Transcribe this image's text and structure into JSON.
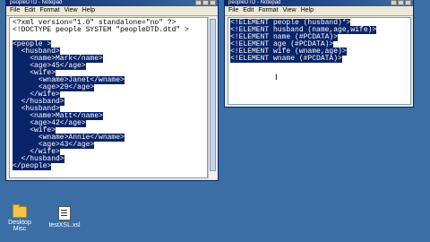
{
  "left_window": {
    "title": "peopleDTD - Notepad",
    "menu": [
      "File",
      "Edit",
      "Format",
      "View",
      "Help"
    ],
    "lines": [
      {
        "text": "<?xml version=\"1.0\" standalone=\"no\" ?>",
        "sel": false
      },
      {
        "text": "<!DOCTYPE people SYSTEM \"peopleDTD.dtd\" >",
        "sel": false
      },
      {
        "text": "",
        "sel": false
      },
      {
        "text": "<people >",
        "sel": true
      },
      {
        "text": "  <husband>",
        "sel": true
      },
      {
        "text": "    <name>Mark</name>",
        "sel": true
      },
      {
        "text": "    <age>45</age>",
        "sel": true
      },
      {
        "text": "    <wife>",
        "sel": true
      },
      {
        "text": "      <wname>Janet</wname>",
        "sel": true
      },
      {
        "text": "      <age>29</age>",
        "sel": true
      },
      {
        "text": "    </wife>",
        "sel": true
      },
      {
        "text": "  </husband>",
        "sel": true
      },
      {
        "text": "  <husband>",
        "sel": true
      },
      {
        "text": "    <name>Matt</name>",
        "sel": true
      },
      {
        "text": "    <age>42</age>",
        "sel": true
      },
      {
        "text": "    <wife>",
        "sel": true
      },
      {
        "text": "      <wname>Annie</wname>",
        "sel": true
      },
      {
        "text": "      <age>43</age>",
        "sel": true
      },
      {
        "text": "    </wife>",
        "sel": true
      },
      {
        "text": "  </husband>",
        "sel": true
      },
      {
        "text": "</people>",
        "sel": true
      }
    ]
  },
  "right_window": {
    "title": "peopleDTD - Notepad",
    "menu": [
      "File",
      "Edit",
      "Format",
      "View",
      "Help"
    ],
    "lines": [
      {
        "text": "<!ELEMENT people (husband)*>",
        "sel": true
      },
      {
        "text": "<!ELEMENT husband (name,age,wife)>",
        "sel": true
      },
      {
        "text": "<!ELEMENT name (#PCDATA)>",
        "sel": true
      },
      {
        "text": "<!ELEMENT age (#PCDATA)>",
        "sel": true
      },
      {
        "text": "<!ELEMENT wife (wname,age)>",
        "sel": true
      },
      {
        "text": "<!ELEMENT wname (#PCDATA)>",
        "sel": true
      }
    ],
    "cursor": "I"
  },
  "desktop": {
    "icons": [
      {
        "label": "Desktop Misc",
        "icon": "folder-icon"
      },
      {
        "label": "testXSL.xsl",
        "icon": "xsl-file-icon"
      }
    ]
  }
}
